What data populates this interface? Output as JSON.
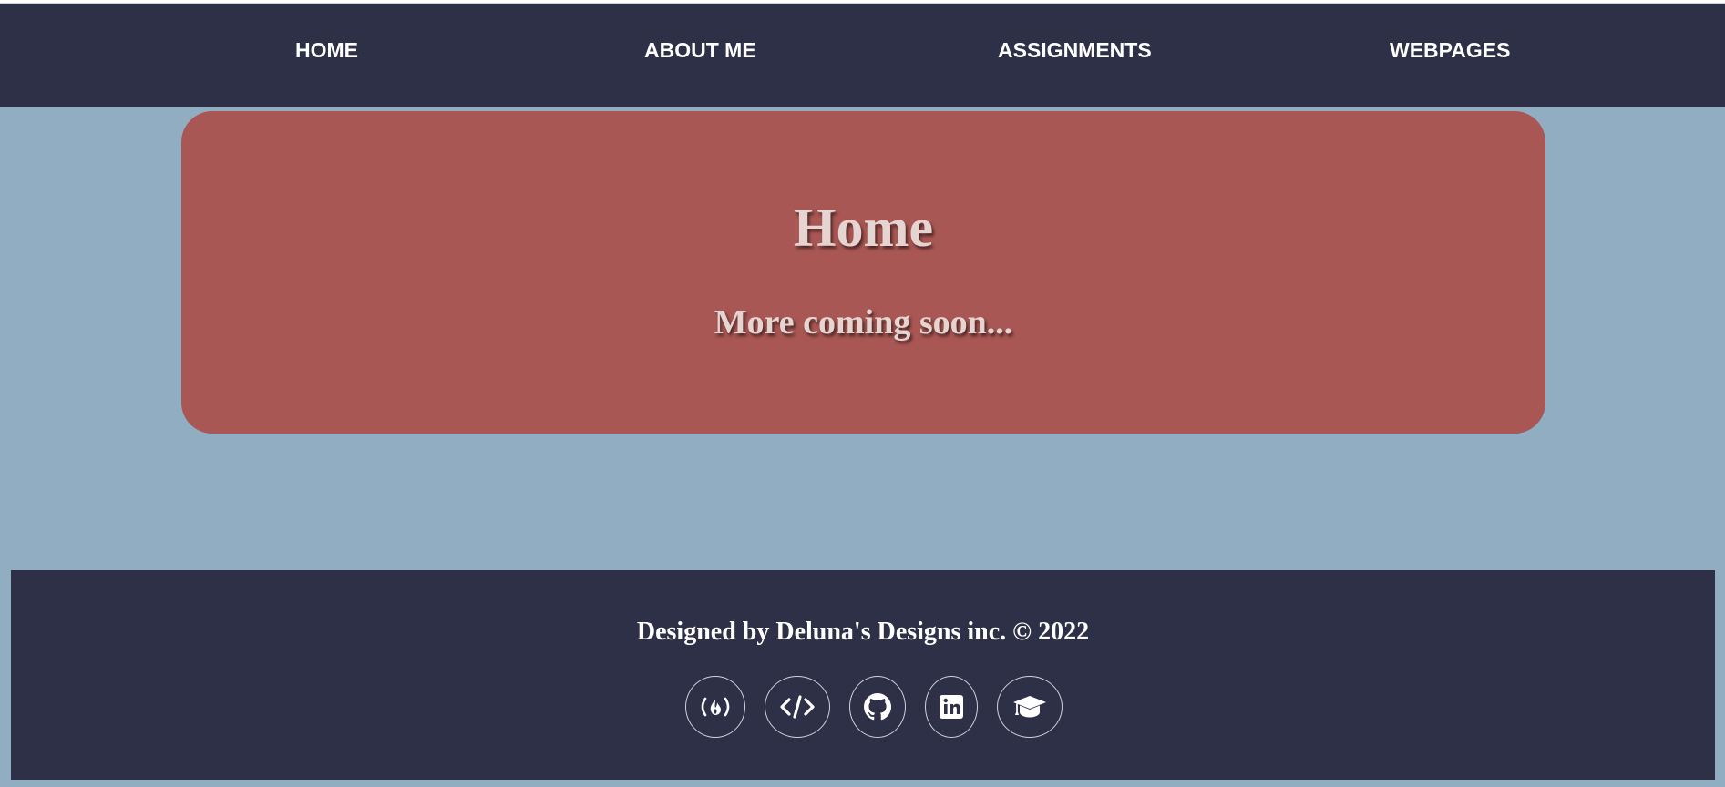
{
  "nav": {
    "items": [
      {
        "label": "HOME"
      },
      {
        "label": "ABOUT ME"
      },
      {
        "label": "ASSIGNMENTS"
      },
      {
        "label": "WEBPAGES"
      }
    ]
  },
  "hero": {
    "title": "Home",
    "subtitle": "More coming soon..."
  },
  "footer": {
    "text": "Designed by Deluna's Designs inc. © 2022",
    "social_icons": [
      "freecodecamp-icon",
      "code-icon",
      "github-icon",
      "linkedin-icon",
      "graduation-cap-icon"
    ]
  },
  "colors": {
    "page_background": "#90adc2",
    "navbar_background": "#2e3048",
    "hero_background": "#a95754",
    "footer_background": "#2e3048",
    "heading_text": "#e6d4d1"
  }
}
